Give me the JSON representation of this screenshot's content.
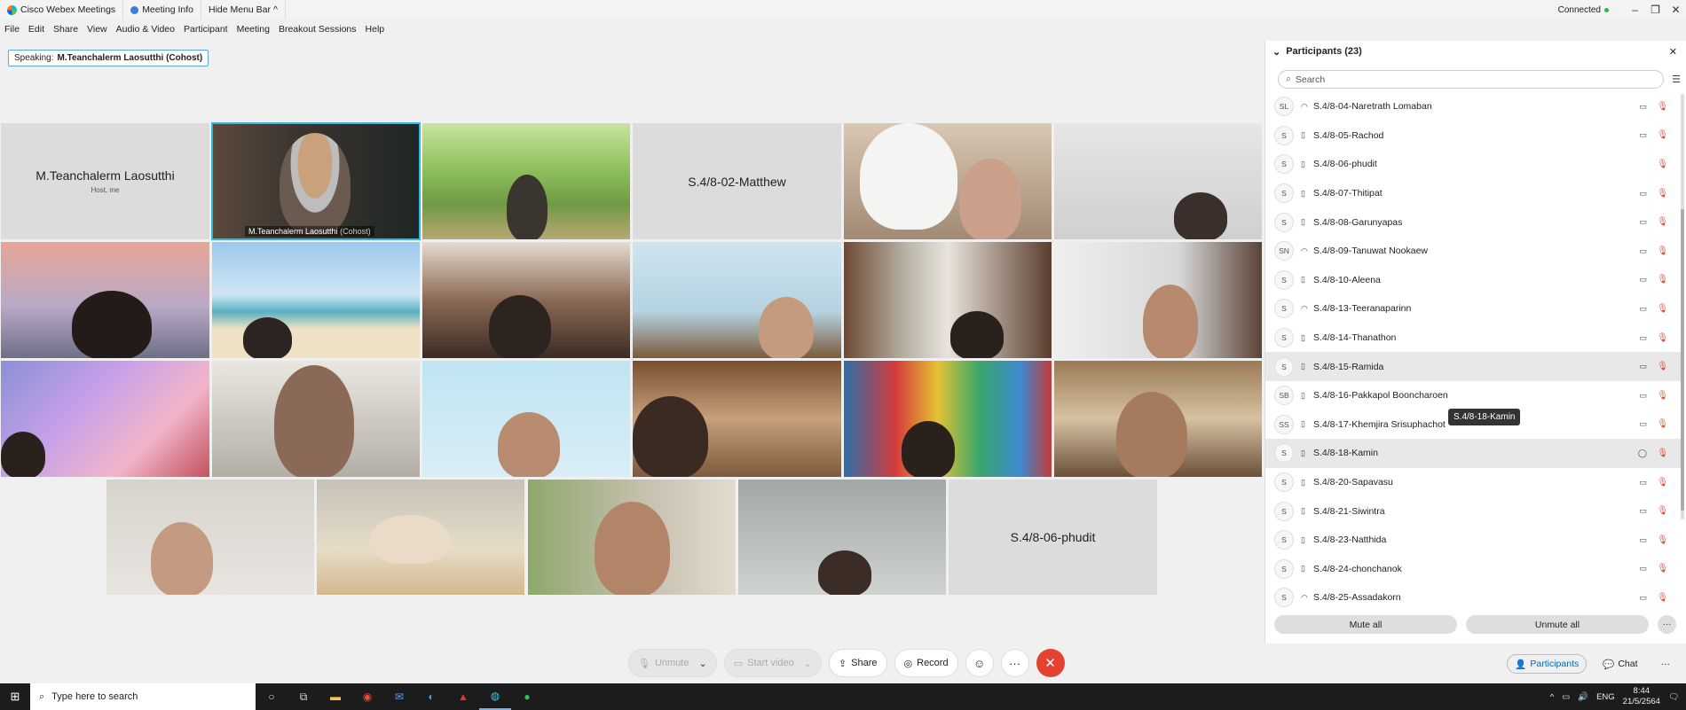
{
  "window": {
    "app_title": "Cisco Webex Meetings",
    "meeting_info": "Meeting Info",
    "hide_menu": "Hide Menu Bar",
    "connection": "Connected",
    "minimize": "–",
    "restore": "❐",
    "close": "✕"
  },
  "menu": [
    "File",
    "Edit",
    "Share",
    "View",
    "Audio & Video",
    "Participant",
    "Meeting",
    "Breakout Sessions",
    "Help"
  ],
  "speaking": {
    "prefix": "Speaking:",
    "name": "M.Teanchalerm Laosutthi (Cohost)"
  },
  "tiles": {
    "host_name": "M.Teanchalerm Laosutthi",
    "host_sub": "Host, me",
    "active_label": "M.Teanchalerm Laosutthi",
    "active_label_role": "(Cohost)",
    "matthew": "S.4/8-02-Matthew",
    "phudit": "S.4/8-06-phudit"
  },
  "controls": {
    "unmute": "Unmute",
    "start_video": "Start video",
    "share": "Share",
    "record": "Record",
    "more": "···"
  },
  "participants_panel": {
    "title": "Participants (23)",
    "search_placeholder": "Search",
    "rows": [
      {
        "initials": "SL",
        "device": "headset",
        "name": "S.4/8-04-Naretrath Lomaban",
        "video": "camera",
        "highlight": false
      },
      {
        "initials": "S",
        "device": "phone",
        "name": "S.4/8-05-Rachod",
        "video": "camera",
        "highlight": false
      },
      {
        "initials": "S",
        "device": "phone",
        "name": "S.4/8-06-phudit",
        "video": "",
        "highlight": false
      },
      {
        "initials": "S",
        "device": "phone",
        "name": "S.4/8-07-Thitipat",
        "video": "camera",
        "highlight": false
      },
      {
        "initials": "S",
        "device": "phone",
        "name": "S.4/8-08-Garunyapas",
        "video": "camera",
        "highlight": false
      },
      {
        "initials": "SN",
        "device": "headset",
        "name": "S.4/8-09-Tanuwat Nookaew",
        "video": "camera",
        "highlight": false
      },
      {
        "initials": "S",
        "device": "phone",
        "name": "S.4/8-10-Aleena",
        "video": "camera",
        "highlight": false
      },
      {
        "initials": "S",
        "device": "headset",
        "name": "S.4/8-13-Teeranaparinn",
        "video": "camera",
        "highlight": false
      },
      {
        "initials": "S",
        "device": "phone",
        "name": "S.4/8-14-Thanathon",
        "video": "camera",
        "highlight": false
      },
      {
        "initials": "S",
        "device": "phone",
        "name": "S.4/8-15-Ramida",
        "video": "camera",
        "highlight": true
      },
      {
        "initials": "SB",
        "device": "phone",
        "name": "S.4/8-16-Pakkapol Booncharoen",
        "video": "camera",
        "highlight": false
      },
      {
        "initials": "SS",
        "device": "phone",
        "name": "S.4/8-17-Khemjira Srisuphachot",
        "video": "camera",
        "highlight": false
      },
      {
        "initials": "S",
        "device": "phone",
        "name": "S.4/8-18-Kamin",
        "video": "chat",
        "highlight": true
      },
      {
        "initials": "S",
        "device": "phone",
        "name": "S.4/8-20-Sapavasu",
        "video": "camera",
        "highlight": false
      },
      {
        "initials": "S",
        "device": "phone",
        "name": "S.4/8-21-Siwintra",
        "video": "camera",
        "highlight": false
      },
      {
        "initials": "S",
        "device": "phone",
        "name": "S.4/8-23-Natthida",
        "video": "camera",
        "highlight": false
      },
      {
        "initials": "S",
        "device": "phone",
        "name": "S.4/8-24-chonchanok",
        "video": "camera",
        "highlight": false
      },
      {
        "initials": "S",
        "device": "headset",
        "name": "S.4/8-25-Assadakorn",
        "video": "camera",
        "highlight": false
      }
    ],
    "tooltip": "S.4/8-18-Kamin",
    "mute_all": "Mute all",
    "unmute_all": "Unmute all"
  },
  "bottom_tabs": {
    "participants": "Participants",
    "chat": "Chat"
  },
  "taskbar": {
    "search_placeholder": "Type here to search",
    "lang": "ENG",
    "time": "8:44",
    "date": "21/5/2564"
  },
  "colors": {
    "accent": "#31b5f0",
    "end_call": "#e2422f",
    "mic_muted": "#e2422f"
  }
}
